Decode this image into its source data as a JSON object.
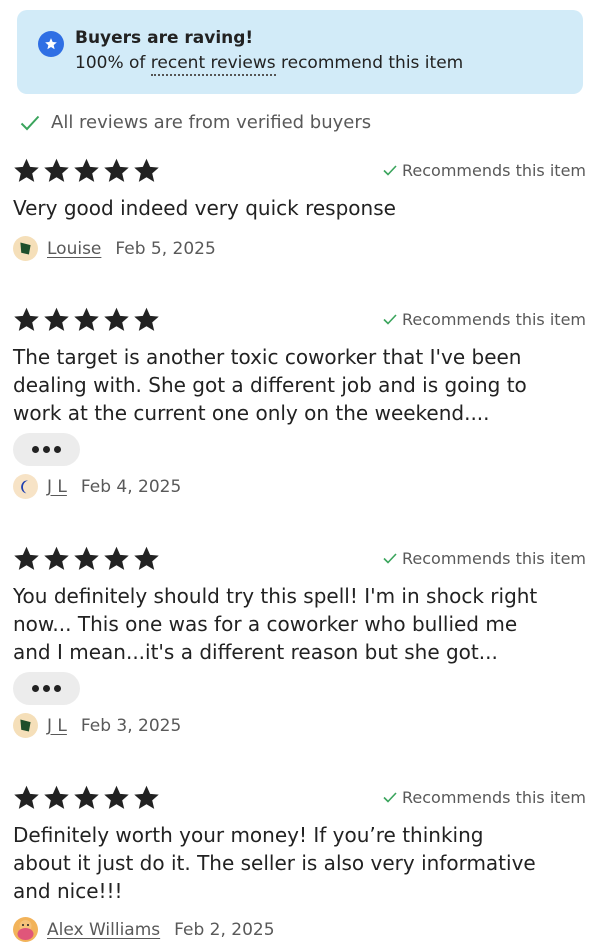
{
  "banner": {
    "title": "Buyers are raving!",
    "subtitle_prefix": "100% of ",
    "subtitle_link": "recent reviews",
    "subtitle_suffix": " recommend this item",
    "icon": "star-badge-icon"
  },
  "verified_note": "All reviews are from verified buyers",
  "colors": {
    "banner_bg": "#d2ebf8",
    "badge_blue": "#2f6fe4",
    "check_green": "#3aa45c",
    "star": "#222222"
  },
  "reviews": [
    {
      "rating": 5,
      "recommends_label": "Recommends this item",
      "text_lines": [
        "Very good indeed very quick response"
      ],
      "author": "Louise",
      "date": "Feb 5, 2025",
      "avatar_icon": "green-pentagon-avatar"
    },
    {
      "rating": 5,
      "recommends_label": "Recommends this item",
      "text_lines": [
        "The target is another toxic coworker that I've been",
        "dealing with. She got a different job and is going to",
        "work at the current one only on the weekend...."
      ],
      "more_button": "expand-more-button",
      "author": "J L",
      "date": "Feb 4, 2025",
      "avatar_icon": "blue-crescent-avatar"
    },
    {
      "rating": 5,
      "recommends_label": "Recommends this item",
      "text_lines": [
        "You definitely should try this spell! I'm in shock right",
        "now... This one was for a coworker who bullied me",
        "and I mean...it's a different reason but she got..."
      ],
      "more_button": "expand-more-button",
      "author": "J L",
      "date": "Feb 3, 2025",
      "avatar_icon": "green-pentagon-avatar"
    },
    {
      "rating": 5,
      "recommends_label": "Recommends this item",
      "text_lines": [
        "Definitely worth your money! If you’re thinking",
        "about it just do it. The seller is also very informative",
        "and nice!!!"
      ],
      "author": "Alex Williams",
      "date": "Feb 2, 2025",
      "avatar_icon": "photo-avatar"
    }
  ]
}
